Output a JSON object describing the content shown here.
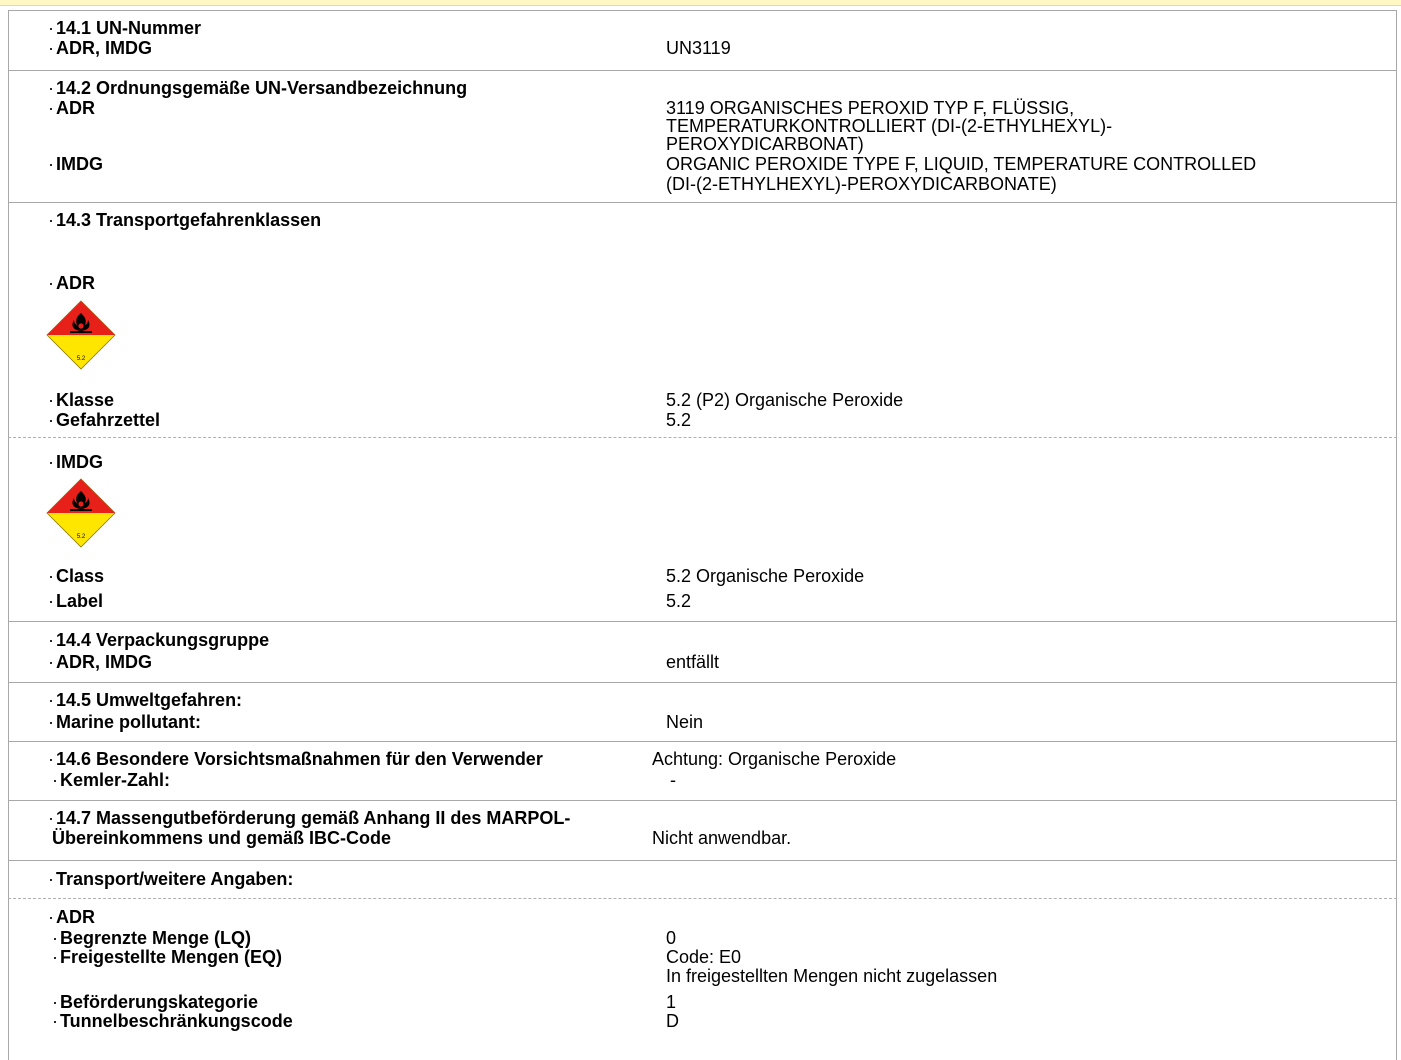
{
  "s1": {
    "title": "14.1 UN-Nummer",
    "row_label": "ADR, IMDG",
    "row_value": "UN3119"
  },
  "s2": {
    "title": "14.2 Ordnungsgemäße UN-Versandbezeichnung",
    "adr_label": "ADR",
    "adr_lines": [
      "3119 ORGANISCHES PEROXID TYP F, FLÜSSIG,",
      "TEMPERATURKONTROLLIERT (DI-(2-ETHYLHEXYL)-",
      "PEROXYDICARBONAT)"
    ],
    "imdg_label": "IMDG",
    "imdg_lines": [
      "ORGANIC PEROXIDE TYPE F, LIQUID, TEMPERATURE CONTROLLED",
      "(DI-(2-ETHYLHEXYL)-PEROXYDICARBONATE)"
    ]
  },
  "s3": {
    "title": "14.3 Transportgefahrenklassen",
    "adr": {
      "label": "ADR",
      "class_label": "Klasse",
      "class_value": "5.2 (P2) Organische Peroxide",
      "tag_label": "Gefahrzettel",
      "tag_value": "5.2"
    },
    "imdg": {
      "label": "IMDG",
      "class_label": "Class",
      "class_value": "5.2 Organische Peroxide",
      "tag_label": "Label",
      "tag_value": "5.2"
    },
    "pictogram_text": "5.2"
  },
  "s4": {
    "title": "14.4 Verpackungsgruppe",
    "row_label": "ADR, IMDG",
    "row_value": "entfällt"
  },
  "s5": {
    "title": "14.5 Umweltgefahren:",
    "row_label": "Marine pollutant:",
    "row_value": "Nein"
  },
  "s6": {
    "title": "14.6 Besondere Vorsichtsmaßnahmen für den Verwender",
    "title_value": "Achtung: Organische Peroxide",
    "row_label": "Kemler-Zahl:",
    "row_value": "-"
  },
  "s7": {
    "title_line1": "14.7 Massengutbeförderung gemäß Anhang II des MARPOL-",
    "title_line2": "Übereinkommens und gemäß IBC-Code",
    "value": "Nicht anwendbar."
  },
  "s8": {
    "title": "Transport/weitere Angaben:",
    "adr_label": "ADR",
    "rows": [
      {
        "label": "Begrenzte Menge (LQ)",
        "value": "0"
      },
      {
        "label": "Freigestellte Mengen (EQ)",
        "value": "Code: E0",
        "value2": "In freigestellten Mengen nicht zugelassen"
      },
      {
        "label": "Beförderungskategorie",
        "value": "1"
      },
      {
        "label": "Tunnelbeschränkungscode",
        "value": "D"
      }
    ]
  },
  "colors": {
    "border": "#a8a8a8",
    "pictogram_red": "#e8201a",
    "pictogram_yellow": "#ffe600",
    "header_band": "#fff8c4"
  },
  "icons": {
    "pictogram": "flame-over-circle-icon"
  }
}
